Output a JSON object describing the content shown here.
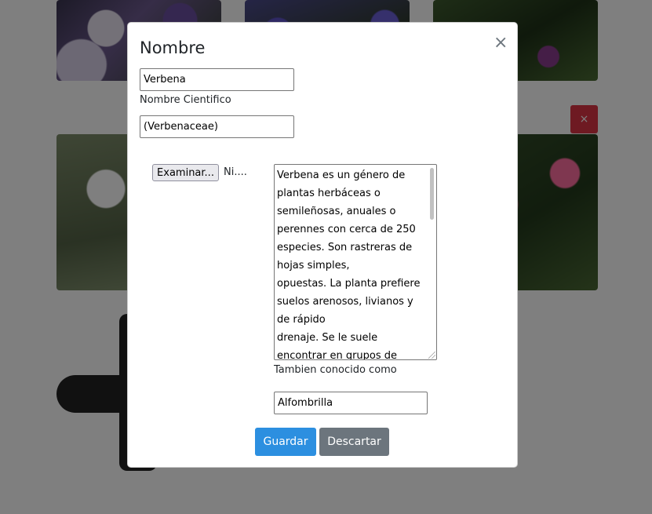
{
  "background": {
    "delete_label": "×",
    "colors": {
      "danger": "#dc3545",
      "backdrop": "rgba(0,0,0,0.5)"
    }
  },
  "modal": {
    "title": "Nombre",
    "close_label": "×",
    "name_value": "Verbena",
    "scientific_label": "Nombre Cientifico",
    "scientific_value": "(Verbenaceae)",
    "file_button_label": "Examinar...",
    "file_status": "Ni....",
    "description": "Verbena es un género de\nplantas herbáceas o\nsemileñosas, anuales o\nperennes con cerca de 250\nespecies. Son rastreras de\nhojas simples,\nopuestas. La planta prefiere\nsuelos arenosos, livianos y\nde rápido\ndrenaje. Se le suele\nencontrar en grupos de",
    "aka_label": "Tambien conocido como",
    "aka_value": "Alfombrilla",
    "save_label": "Guardar",
    "discard_label": "Descartar",
    "colors": {
      "primary": "#2c8fe0",
      "secondary": "#6c757d"
    }
  }
}
